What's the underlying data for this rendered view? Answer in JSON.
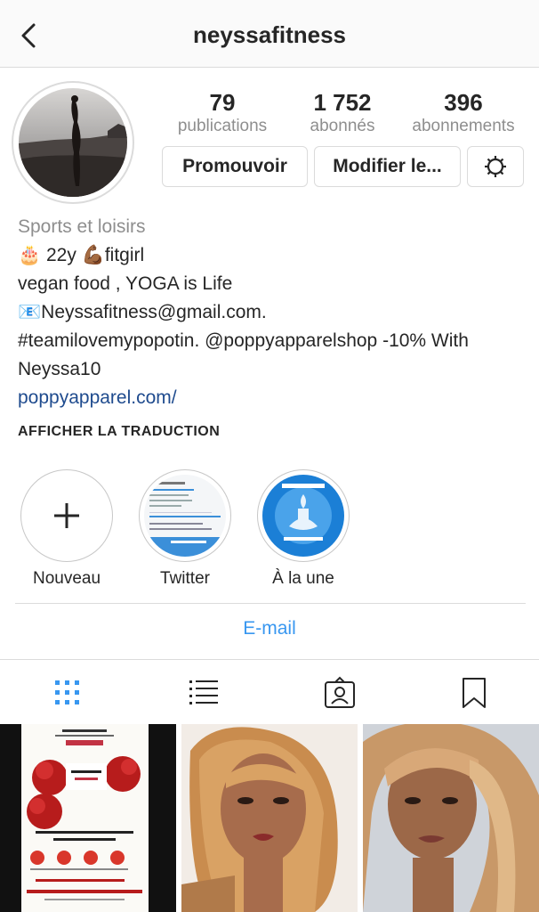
{
  "header": {
    "title": "neyssafitness",
    "back_icon": "chevron-left-icon"
  },
  "stats": [
    {
      "value": "79",
      "label": "publications"
    },
    {
      "value": "1 752",
      "label": "abonnés"
    },
    {
      "value": "396",
      "label": "abonnements"
    }
  ],
  "actions": {
    "promote": "Promouvoir",
    "edit": "Modifier le...",
    "settings_icon": "gear-icon"
  },
  "bio": {
    "category": "Sports et loisirs",
    "line1": "🎂 22y 💪🏾fitgirl",
    "line2": "vegan food , YOGA is Life",
    "line3": "📧Neyssafitness@gmail.com.",
    "line4": "#teamilovemypopotin. @poppyapparelshop -10% With",
    "line5": "Neyssa10",
    "link": "poppyapparel.com/",
    "translate": "AFFICHER LA TRADUCTION"
  },
  "highlights": [
    {
      "label": "Nouveau"
    },
    {
      "label": "Twitter"
    },
    {
      "label": "À la une"
    }
  ],
  "contact": {
    "email": "E-mail"
  },
  "tabs": [
    "grid-icon",
    "list-icon",
    "tagged-icon",
    "saved-icon"
  ],
  "colors": {
    "link": "#1f4b8e",
    "accent": "#3897f0",
    "muted": "#8e8e8e",
    "border": "#dbdbdb"
  }
}
